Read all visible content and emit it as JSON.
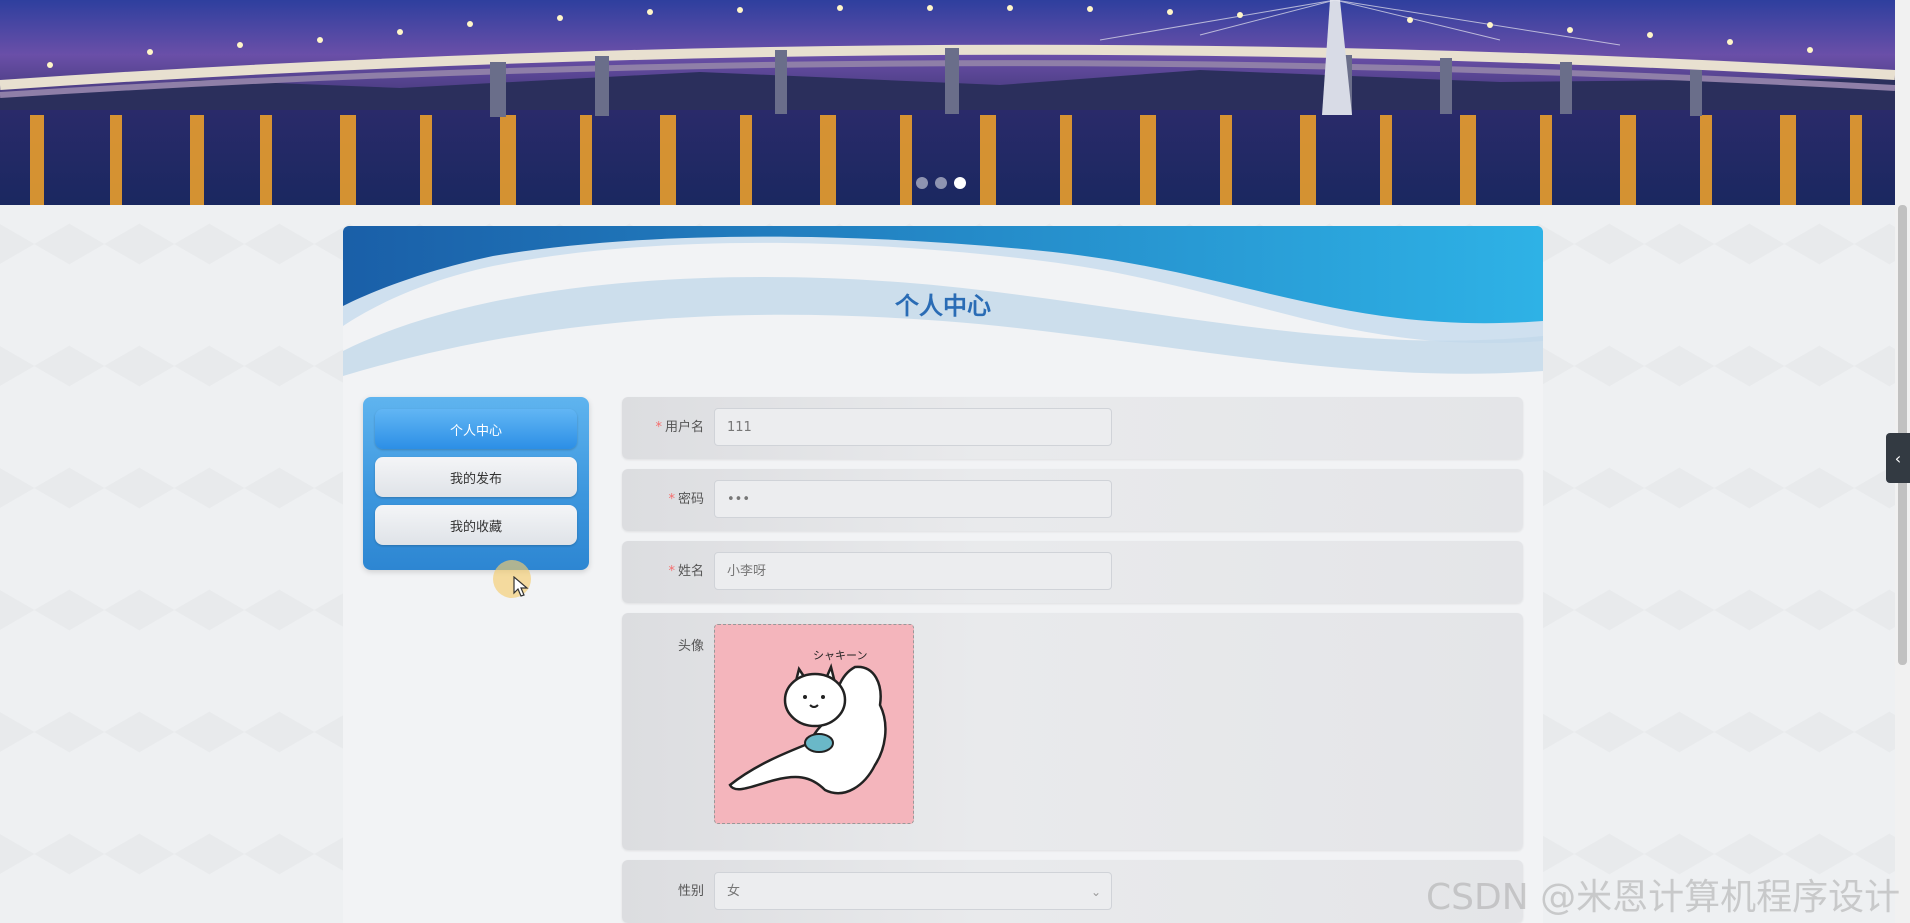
{
  "carousel": {
    "slide_count": 3,
    "active_slide": 3
  },
  "page": {
    "title": "个人中心"
  },
  "menu": {
    "items": [
      {
        "label": "个人中心",
        "active": true
      },
      {
        "label": "我的发布",
        "active": false
      },
      {
        "label": "我的收藏",
        "active": false
      }
    ]
  },
  "form": {
    "username": {
      "label": "用户名",
      "required": true,
      "value": "111"
    },
    "password": {
      "label": "密码",
      "required": true,
      "value": "•••"
    },
    "name": {
      "label": "姓名",
      "required": true,
      "value": "小李呀"
    },
    "avatar": {
      "label": "头像",
      "caption": "シャキーン"
    },
    "gender": {
      "label": "性别",
      "value": "女"
    }
  },
  "watermark": "CSDN @米恩计算机程序设计",
  "colors": {
    "accent": "#2a6cb5",
    "menu_blue": "#3d97de",
    "required": "#f56c6c"
  },
  "icons": {
    "side_tab": "chevron-left-icon",
    "select": "chevron-down-icon"
  }
}
